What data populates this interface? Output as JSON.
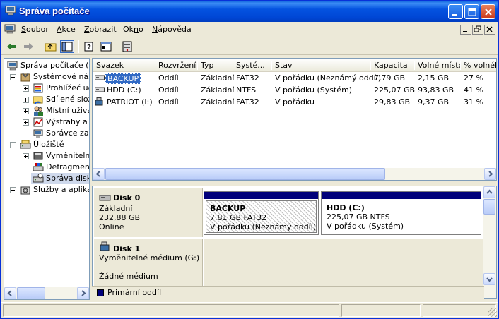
{
  "window": {
    "title": "Správa počítače",
    "accent_color": "#0453e0",
    "partition_color": "#00007a"
  },
  "menu": {
    "items": [
      {
        "pre": "",
        "key": "S",
        "post": "oubor"
      },
      {
        "pre": "",
        "key": "A",
        "post": "kce"
      },
      {
        "pre": "",
        "key": "Z",
        "post": "obrazit"
      },
      {
        "pre": "Ok",
        "key": "n",
        "post": "o"
      },
      {
        "pre": "",
        "key": "N",
        "post": "ápověda"
      }
    ]
  },
  "toolbar": {
    "icons": [
      "back-icon",
      "forward-icon",
      "up-folder-icon",
      "show-hide-tree-icon",
      "help-icon",
      "properties-icon",
      "settings-icon"
    ]
  },
  "tree": {
    "items": [
      {
        "label": "Správa počítače (místní)",
        "icon": "computer-icon"
      },
      {
        "label": "Systémové nástroje",
        "icon": "tools-icon"
      },
      {
        "label": "Prohlížeč událostí",
        "icon": "event-viewer-icon"
      },
      {
        "label": "Sdílené složky",
        "icon": "shared-folder-icon"
      },
      {
        "label": "Místní uživatelé a skupiny",
        "icon": "users-icon"
      },
      {
        "label": "Výstrahy a protokoly výkonu",
        "icon": "performance-icon"
      },
      {
        "label": "Správce zařízení",
        "icon": "device-manager-icon"
      },
      {
        "label": "Úložiště",
        "icon": "storage-icon"
      },
      {
        "label": "Vyměnitelné úložiště",
        "icon": "removable-storage-icon"
      },
      {
        "label": "Defragmentace disku",
        "icon": "defrag-icon"
      },
      {
        "label": "Správa disků",
        "icon": "disk-management-icon"
      },
      {
        "label": "Služby a aplikace",
        "icon": "services-icon"
      }
    ]
  },
  "volumes": {
    "columns": [
      "Svazek",
      "Rozvržení",
      "Typ",
      "Systé...",
      "Stav",
      "Kapacita",
      "Volné místo",
      "% volného"
    ],
    "rows": [
      {
        "name": "BACKUP",
        "layout": "Oddíl",
        "type": "Základní",
        "fs": "FAT32",
        "status": "V pořádku (Neznámý oddíl)",
        "capacity": "7,79 GB",
        "free": "2,15 GB",
        "pct": "27 %"
      },
      {
        "name": "HDD (C:)",
        "layout": "Oddíl",
        "type": "Základní",
        "fs": "NTFS",
        "status": "V pořádku (Systém)",
        "capacity": "225,07 GB",
        "free": "93,83 GB",
        "pct": "41 %"
      },
      {
        "name": "PATRIOT (I:)",
        "layout": "Oddíl",
        "type": "Základní",
        "fs": "FAT32",
        "status": "V pořádku",
        "capacity": "29,83 GB",
        "free": "9,37 GB",
        "pct": "31 %"
      }
    ]
  },
  "disks": {
    "disk0": {
      "name": "Disk 0",
      "kind": "Základní",
      "size": "232,88 GB",
      "state": "Online",
      "partitions": [
        {
          "name": "BACKUP",
          "size": "7,81 GB FAT32",
          "status": "V pořádku (Neznámý oddíl)"
        },
        {
          "name": "HDD  (C:)",
          "size": "225,07 GB NTFS",
          "status": "V pořádku (Systém)"
        }
      ]
    },
    "disk1": {
      "name": "Disk 1",
      "kind": "Vyměnitelné médium (G:)",
      "state": "Žádné médium"
    }
  },
  "legend": {
    "primary": "Primární oddíl"
  }
}
